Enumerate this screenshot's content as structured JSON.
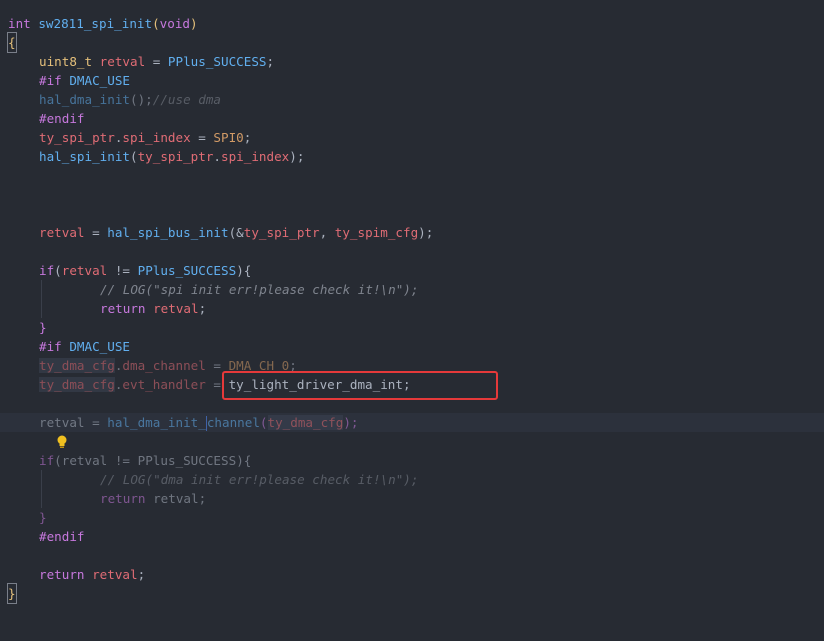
{
  "code": {
    "line_signature": {
      "kw": "int",
      "fn": "sw2811_spi_init",
      "open": "(",
      "param": "void",
      "close": ")"
    },
    "line_open_brace": "{",
    "line_retval_decl": {
      "type": "uint8_t",
      "var": "retval",
      "eq": " = ",
      "mac": "PPlus_SUCCESS",
      "end": ";"
    },
    "line_if_dmac": {
      "kw": "#if",
      "mac": "DMAC_USE"
    },
    "line_hal_dma_init": {
      "fn": "hal_dma_init",
      "args": "();",
      "comment": "//use dma"
    },
    "line_endif1": "#endif",
    "line_spi_index": {
      "var": "ty_spi_ptr",
      "dot": ".",
      "field": "spi_index",
      "eq": " = ",
      "mac": "SPI0",
      "end": ";"
    },
    "line_hal_spi_init": {
      "fn": "hal_spi_init",
      "open": "(",
      "var": "ty_spi_ptr",
      "dot": ".",
      "field": "spi_index",
      "close": ");"
    },
    "line_bus_init": {
      "var": "retval",
      "eq": " = ",
      "fn": "hal_spi_bus_init",
      "open": "(&",
      "arg1": "ty_spi_ptr",
      "comma": ", ",
      "arg2": "ty_spim_cfg",
      "close": ");"
    },
    "line_if1": {
      "kw": "if",
      "open": "(",
      "var": "retval",
      "op": " != ",
      "mac": "PPlus_SUCCESS",
      "close": "){"
    },
    "line_log1": "// LOG(\"spi init err!please check it!\\n\");",
    "line_return1": {
      "kw": "return",
      "var": "retval",
      "end": ";"
    },
    "line_close1": "}",
    "line_if_dmac2": {
      "kw": "#if",
      "mac": "DMAC_USE"
    },
    "line_dma_channel": {
      "var": "ty_dma_cfg",
      "dot": ".",
      "field": "dma_channel",
      "eq": " = ",
      "mac": "DMA_CH_0",
      "end": ";"
    },
    "line_evt_handler": {
      "var": "ty_dma_cfg",
      "dot": ".",
      "field": "evt_handler",
      "eq": " = ",
      "value": "ty_light_driver_dma_int",
      "end": ";"
    },
    "line_dma_init_channel": {
      "var": "retval",
      "eq": " = ",
      "fn1": "hal_dma_init_",
      "fn2": "channel",
      "open": "(",
      "arg": "ty_dma_cfg",
      "close": ");"
    },
    "line_if2": {
      "kw": "if",
      "open": "(",
      "var": "retval",
      "op": " != ",
      "mac": "PPlus_SUCCESS",
      "close": "){"
    },
    "line_log2": "// LOG(\"dma init err!please check it!\\n\");",
    "line_return2": {
      "kw": "return",
      "var": "retval",
      "end": ";"
    },
    "line_close2": "}",
    "line_endif2": "#endif",
    "line_return3": {
      "kw": "return",
      "var": "retval",
      "end": ";"
    },
    "line_close_brace": "}"
  },
  "icons": {
    "lightbulb": "lightbulb-icon"
  },
  "colors": {
    "background": "#272b33",
    "keyword": "#c678dd",
    "function": "#61afef",
    "type": "#e5c07b",
    "variable": "#e06c75",
    "macro": "#d19a66",
    "highlight_box": "#e5393a"
  }
}
